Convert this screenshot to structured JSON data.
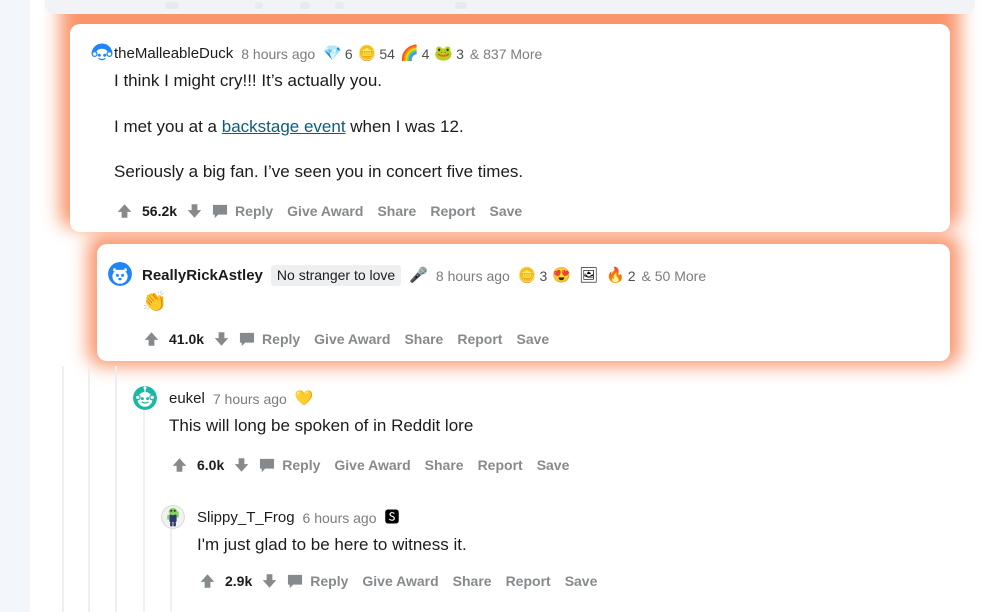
{
  "theme": {
    "highlight_color": "#f9956b",
    "card_color": "#ffffff",
    "gutter_color": "#f3f6fa",
    "link_color": "#0f5c78",
    "meta_color": "#7c7c7c",
    "action_color": "#878a8c",
    "threadline_color": "#edeff1"
  },
  "actions": {
    "reply": "Reply",
    "give_award": "Give Award",
    "share": "Share",
    "report": "Report",
    "save": "Save"
  },
  "comments": [
    {
      "id": "c1",
      "username": "theMalleableDuck",
      "age": "8 hours ago",
      "highlighted": true,
      "score": "56.2k",
      "awards": [
        {
          "icon": "gem-award-icon",
          "glyph": "💎",
          "count": "6"
        },
        {
          "icon": "silver-award-icon",
          "glyph": "🪙",
          "count": "54"
        },
        {
          "icon": "rainbow-award-icon",
          "glyph": "🌈",
          "count": "4"
        },
        {
          "icon": "frog-award-icon",
          "glyph": "🐸",
          "count": "3"
        }
      ],
      "more_awards": "& 837 More",
      "body": [
        {
          "text": "I think I might cry!!! It’s actually you."
        },
        {
          "pre": "I met you at a ",
          "link": "backstage event",
          "post": " when I was 12."
        },
        {
          "text": "Seriously a big fan. I’ve seen you in concert five times."
        }
      ]
    },
    {
      "id": "c2",
      "username": "ReallyRickAstley",
      "flair": "No stranger to love",
      "mic": "🎤",
      "age": "8 hours ago",
      "highlighted": true,
      "score": "41.0k",
      "awards": [
        {
          "icon": "silver-award-icon",
          "glyph": "🪙",
          "count": "3"
        },
        {
          "icon": "heart-eyes-award-icon",
          "glyph": "😍",
          "count": ""
        },
        {
          "icon": "framed-award-icon",
          "glyph": "🖼",
          "count": ""
        },
        {
          "icon": "flame-award-icon",
          "glyph": "🔥",
          "count": "2"
        }
      ],
      "more_awards": "& 50 More",
      "emoji_body": "👏"
    },
    {
      "id": "c3",
      "username": "eukel",
      "age": "7 hours ago",
      "highlighted": false,
      "score": "6.0k",
      "awards": [
        {
          "icon": "heart-gold-award-icon",
          "glyph": "💛",
          "count": ""
        }
      ],
      "more_awards": "",
      "body": [
        {
          "text": "This will long be spoken of in Reddit lore"
        }
      ]
    },
    {
      "id": "c4",
      "username": "Slippy_T_Frog",
      "age": "6 hours ago",
      "highlighted": false,
      "score": "2.9k",
      "awards": [
        {
          "icon": "silver-s-award-icon",
          "glyph": "🆂",
          "count": ""
        }
      ],
      "more_awards": "",
      "body": [
        {
          "text": "I'm just glad to be here to witness it."
        }
      ]
    }
  ]
}
